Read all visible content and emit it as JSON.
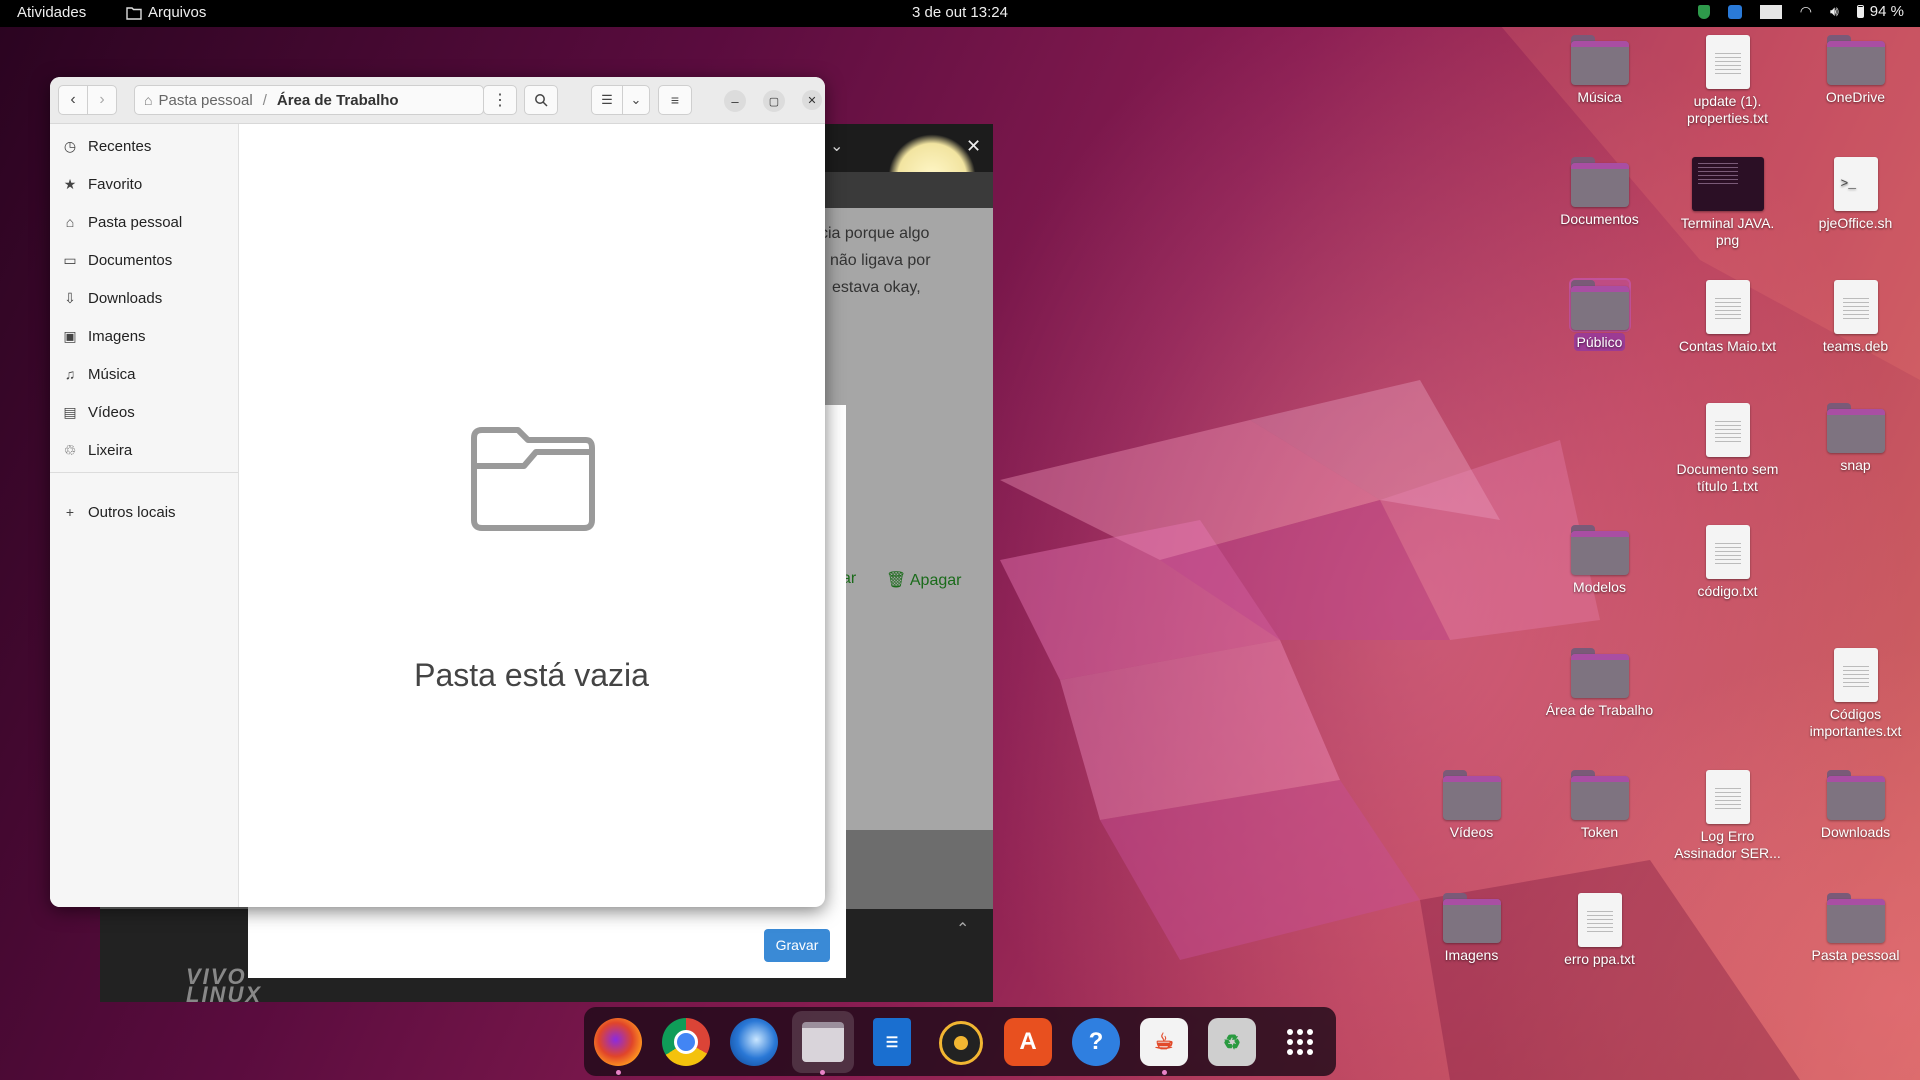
{
  "topbar": {
    "activities": "Atividades",
    "app_name": "Arquivos",
    "clock": "3 de out  13:24",
    "battery": "94 %"
  },
  "desktop": {
    "icons": [
      {
        "label": "Música",
        "type": "folder"
      },
      {
        "label": "update (1).\nproperties.txt",
        "type": "doc"
      },
      {
        "label": "OneDrive",
        "type": "folder"
      },
      {
        "label": "Documentos",
        "type": "folder"
      },
      {
        "label": "Terminal JAVA.\npng",
        "type": "image"
      },
      {
        "label": "pjeOffice.sh",
        "type": "script"
      },
      {
        "label": "Público",
        "type": "folder"
      },
      {
        "label": "Contas Maio.txt",
        "type": "doc"
      },
      {
        "label": "teams.deb",
        "type": "doc"
      },
      {
        "label": "Documento sem\ntítulo 1.txt",
        "type": "doc"
      },
      {
        "label": "snap",
        "type": "folder"
      },
      {
        "label": "Modelos",
        "type": "folder"
      },
      {
        "label": "código.txt",
        "type": "doc"
      },
      {
        "label": "Área de Trabalho",
        "type": "folder"
      },
      {
        "label": "Códigos\nimportantes.txt",
        "type": "doc"
      },
      {
        "label": "Vídeos",
        "type": "folder"
      },
      {
        "label": "Token",
        "type": "folder"
      },
      {
        "label": "Log Erro\nAssinador SER...",
        "type": "doc"
      },
      {
        "label": "Downloads",
        "type": "folder"
      },
      {
        "label": "Imagens",
        "type": "folder"
      },
      {
        "label": "erro ppa.txt",
        "type": "doc"
      },
      {
        "label": "Pasta pessoal",
        "type": "folder"
      }
    ]
  },
  "background_window": {
    "text_lines": [
      "cia porque algo",
      "não ligava por",
      "estava okay,"
    ],
    "apagar_partial": "ar",
    "apagar": "Apagar",
    "gravar": "Gravar",
    "brand_line1": "VIVO",
    "brand_line2": "LINUX"
  },
  "file_window": {
    "breadcrumb_home": "Pasta pessoal",
    "breadcrumb_current": "Área de Trabalho",
    "sidebar": [
      {
        "label": "Recentes",
        "icon": "clock-icon"
      },
      {
        "label": "Favorito",
        "icon": "star-icon"
      },
      {
        "label": "Pasta pessoal",
        "icon": "home-icon"
      },
      {
        "label": "Documentos",
        "icon": "document-icon"
      },
      {
        "label": "Downloads",
        "icon": "download-icon"
      },
      {
        "label": "Imagens",
        "icon": "image-icon"
      },
      {
        "label": "Música",
        "icon": "music-icon"
      },
      {
        "label": "Vídeos",
        "icon": "film-icon"
      },
      {
        "label": "Lixeira",
        "icon": "trash-icon"
      }
    ],
    "other_locations": "Outros locais",
    "empty_message": "Pasta está vazia"
  },
  "dock": {
    "apps": [
      "Firefox",
      "Chrome",
      "Thunderbird",
      "Arquivos",
      "LibreOffice Writer",
      "Rhythmbox",
      "Ubuntu Software",
      "Ajuda",
      "Java",
      "Lixeira",
      "Mostrar aplicativos"
    ]
  }
}
